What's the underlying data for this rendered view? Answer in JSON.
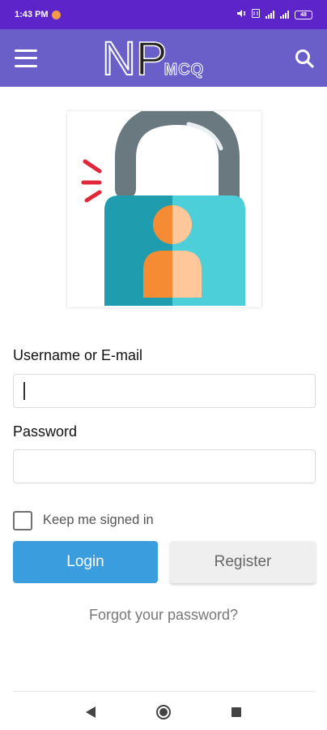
{
  "status_bar": {
    "time": "1:43 PM",
    "battery": "48"
  },
  "app_bar": {
    "logo_n": "N",
    "logo_p": "P",
    "logo_mcq": "MCQ"
  },
  "form": {
    "username_label": "Username or E-mail",
    "username_value": "",
    "password_label": "Password",
    "password_value": "",
    "keep_signed_in_label": "Keep me signed in",
    "keep_signed_in_checked": false,
    "login_label": "Login",
    "register_label": "Register",
    "forgot_label": "Forgot your password?"
  },
  "colors": {
    "status_bar": "#5d24c9",
    "app_bar": "#6a5fc9",
    "login_button": "#3a9ede",
    "register_button": "#efefef"
  },
  "icons": {
    "menu": "menu-icon",
    "search": "search-icon",
    "lock": "user-lock-icon",
    "nav_back": "back-triangle-icon",
    "nav_home": "home-circle-icon",
    "nav_recent": "recent-square-icon"
  }
}
